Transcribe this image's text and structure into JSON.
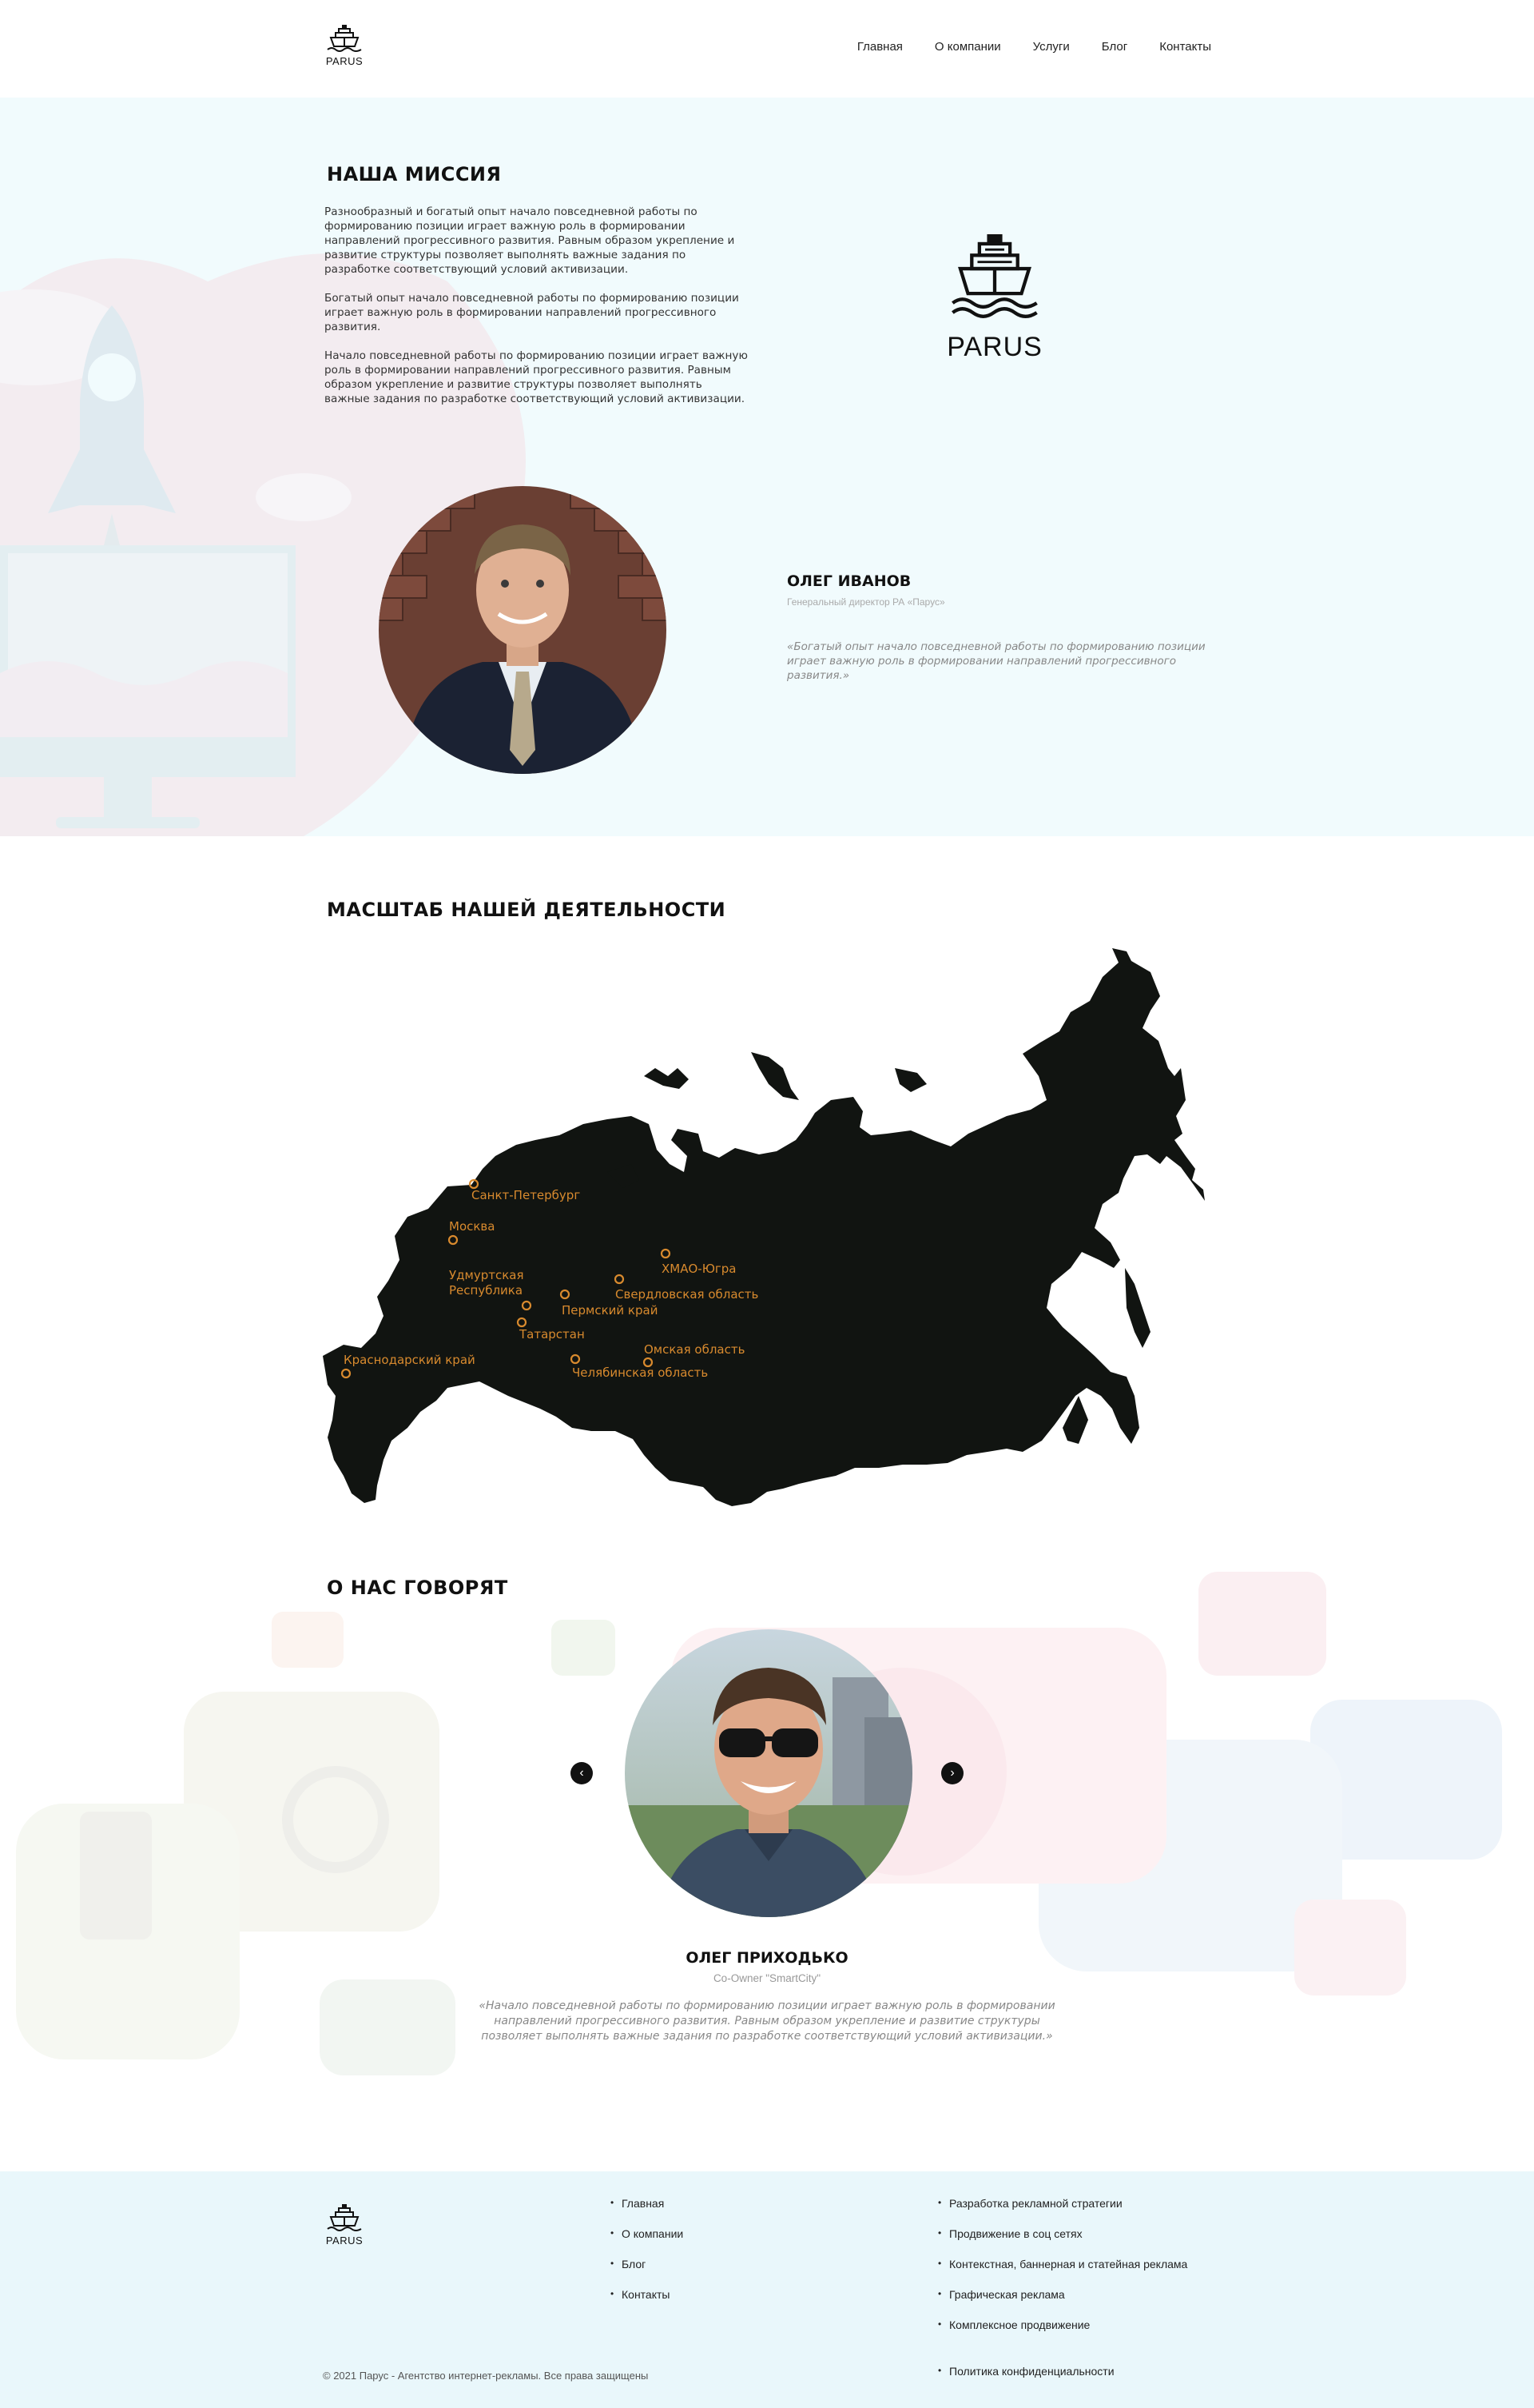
{
  "header": {
    "logo_text": "PARUS",
    "nav": [
      "Главная",
      "О компании",
      "Услуги",
      "Блог",
      "Контакты"
    ]
  },
  "mission": {
    "title": "НАША МИССИЯ",
    "paragraphs": [
      "Разнообразный и богатый опыт начало повседневной работы по формированию позиции играет важную роль в формировании направлений прогрессивного развития. Равным образом укрепление и развитие структуры позволяет выполнять важные задания по разработке соответствующий условий активизации.",
      "Богатый опыт начало повседневной работы по формированию позиции играет важную роль в формировании направлений прогрессивного развития.",
      "Начало повседневной работы по формированию позиции играет важную роль в формировании направлений прогрессивного развития. Равным образом укрепление и развитие структуры позволяет выполнять важные задания по разработке соответствующий условий активизации."
    ],
    "logo_text": "PARUS",
    "person": {
      "name": "ОЛЕГ ИВАНОВ",
      "role": "Генеральный директор РА «Парус»",
      "quote": "«Богатый опыт начало повседневной работы по формированию позиции играет важную роль в формировании направлений прогрессивного развития.»"
    }
  },
  "scale": {
    "title": "МАСШТАБ НАШЕЙ ДЕЯТЕЛЬНОСТИ",
    "cities": [
      "Санкт-Петербург",
      "Москва",
      "Удмуртская Республика",
      "Пермский край",
      "Татарстан",
      "ХМАО-Югра",
      "Свердловская область",
      "Краснодарский край",
      "Омская область",
      "Челябинская область"
    ]
  },
  "reviews": {
    "title": "О НАС ГОВОРЯТ",
    "prev_label": "‹",
    "next_label": "›",
    "person": {
      "name": "ОЛЕГ ПРИХОДЬКО",
      "role": "Co-Owner \"SmartCity\"",
      "quote": "«Начало повседневной работы по формированию позиции играет важную роль в формировании направлений прогрессивного развития. Равным образом укрепление и развитие структуры позволяет выполнять важные задания по разработке соответствующий условий активизации.»"
    }
  },
  "footer": {
    "logo_text": "PARUS",
    "nav": [
      "Главная",
      "О компании",
      "Блог",
      "Контакты"
    ],
    "services": [
      "Разработка рекламной стратегии",
      "Продвижение в соц сетях",
      "Контекстная, баннерная и статейная реклама",
      "Графическая реклама",
      "Комплексное продвижение"
    ],
    "privacy": "Политика конфиденциальности",
    "copyright": "© 2021 Парус - Агентство интернет-рекламы. Все права защищены"
  },
  "colors": {
    "mission_bg": "#f1fbfd",
    "footer_bg": "#e9f7fb",
    "city_marker": "#d88a2e",
    "map_fill": "#111411"
  }
}
